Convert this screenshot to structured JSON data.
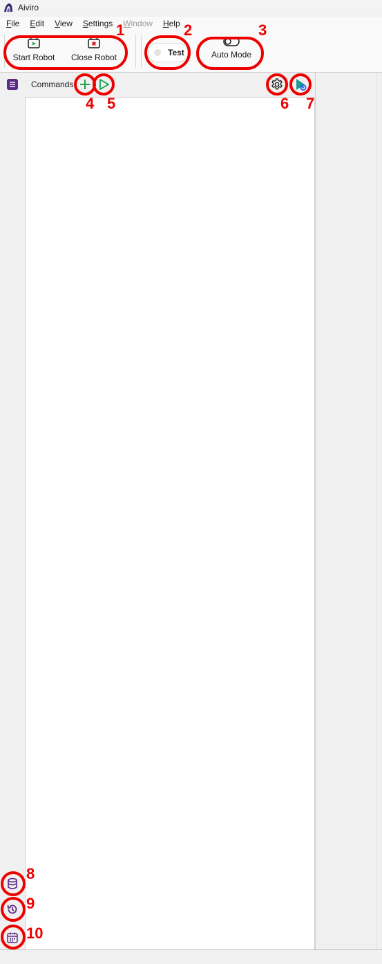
{
  "window": {
    "title": "Aiviro"
  },
  "menu": [
    {
      "label": "File",
      "accel": "F",
      "rest": "ile",
      "enabled": true
    },
    {
      "label": "Edit",
      "accel": "E",
      "rest": "dit",
      "enabled": true
    },
    {
      "label": "View",
      "accel": "V",
      "rest": "iew",
      "enabled": true
    },
    {
      "label": "Settings",
      "accel": "S",
      "rest": "ettings",
      "enabled": true
    },
    {
      "label": "Window",
      "accel": "W",
      "rest": "indow",
      "enabled": false
    },
    {
      "label": "Help",
      "accel": "H",
      "rest": "elp",
      "enabled": true
    }
  ],
  "toolbar": {
    "start_robot": "Start Robot",
    "close_robot": "Close Robot",
    "test_toggle": "Test",
    "auto_mode": "Auto Mode"
  },
  "panel": {
    "title": "Commands"
  },
  "annotations": [
    "1",
    "2",
    "3",
    "4",
    "5",
    "6",
    "7",
    "8",
    "9",
    "10"
  ],
  "colors": {
    "accent_green": "#16a34a",
    "accent_red": "#dc2626",
    "accent_purple": "#5b2a86",
    "annotation_red": "#ee0000"
  }
}
